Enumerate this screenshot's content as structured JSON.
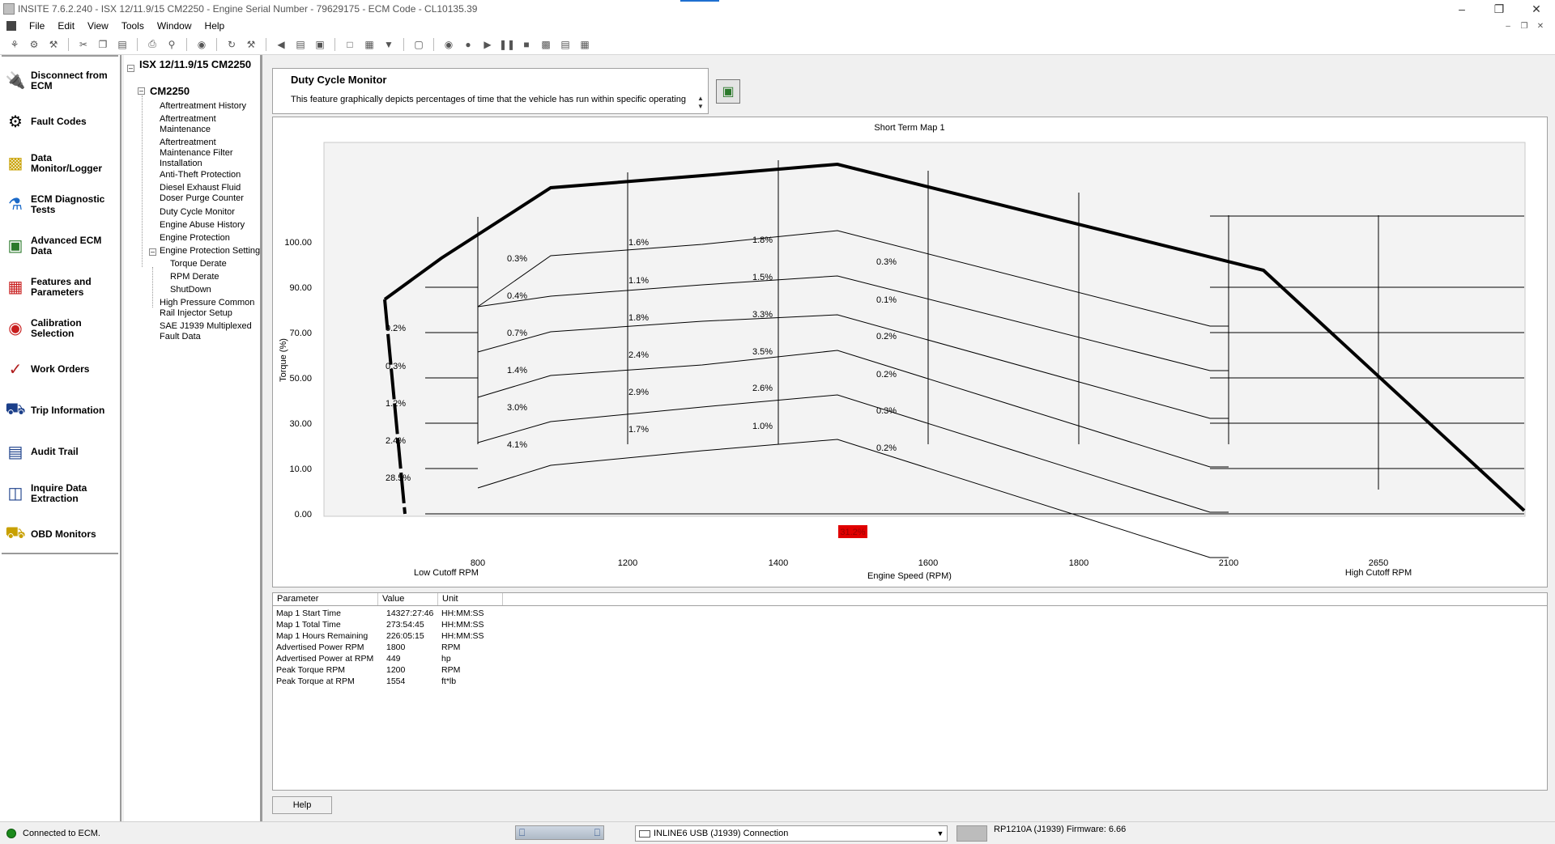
{
  "window": {
    "title": "INSITE 7.6.2.240 - ISX 12/11.9/15 CM2250 - Engine Serial Number - 79629175 - ECM Code - CL10135.39",
    "min_icon": "minimize-icon",
    "max_icon": "restore-icon",
    "close_icon": "close-icon"
  },
  "menubar": {
    "items": [
      "File",
      "Edit",
      "View",
      "Tools",
      "Window",
      "Help"
    ]
  },
  "nav": {
    "items": [
      {
        "label": "Disconnect from ECM",
        "icon": "disconnect-icon"
      },
      {
        "label": "Fault Codes",
        "icon": "fault-codes-icon"
      },
      {
        "label": "Data Monitor/Logger",
        "icon": "data-monitor-icon"
      },
      {
        "label": "ECM Diagnostic Tests",
        "icon": "diagnostic-tests-icon"
      },
      {
        "label": "Advanced ECM Data",
        "icon": "advanced-ecm-icon"
      },
      {
        "label": "Features and Parameters",
        "icon": "features-icon"
      },
      {
        "label": "Calibration Selection",
        "icon": "calibration-icon"
      },
      {
        "label": "Work Orders",
        "icon": "work-orders-icon"
      },
      {
        "label": "Trip Information",
        "icon": "trip-info-icon"
      },
      {
        "label": "Audit Trail",
        "icon": "audit-trail-icon"
      },
      {
        "label": "Inquire Data Extraction",
        "icon": "data-extraction-icon"
      },
      {
        "label": "OBD Monitors",
        "icon": "obd-icon"
      }
    ]
  },
  "tree": {
    "root": "ISX 12/11.9/15 CM2250",
    "child": "CM2250",
    "leaves": [
      "Aftertreatment History",
      "Aftertreatment Maintenance",
      "Aftertreatment Maintenance Filter Installation",
      "Anti-Theft Protection",
      "Diesel Exhaust Fluid Doser Purge Counter",
      "Duty Cycle Monitor",
      "Engine Abuse History",
      "Engine Protection",
      "Engine Protection Setting",
      "Torque Derate",
      "RPM Derate",
      "ShutDown",
      "High Pressure Common Rail Injector Setup",
      "SAE J1939 Multiplexed Fault Data"
    ]
  },
  "description": {
    "title": "Duty Cycle Monitor",
    "text": "This feature graphically depicts percentages of time that the vehicle has run within specific operating"
  },
  "chart_data": {
    "type": "area",
    "title": "Short Term Map 1",
    "xlabel": "Engine Speed (RPM)",
    "ylabel": "Torque (%)",
    "x_ticks": [
      "800",
      "1200",
      "1400",
      "1600",
      "1800",
      "2100",
      "2650"
    ],
    "x_tick_sublabels": {
      "800": "Low Cutoff RPM",
      "2650": "High Cutoff RPM"
    },
    "y_ticks": [
      "0.00",
      "10.00",
      "30.00",
      "50.00",
      "70.00",
      "90.00",
      "100.00"
    ],
    "cells": [
      [
        "0.2%",
        "0.3%",
        "1.2%",
        "2.4%",
        "28.5%"
      ],
      [
        "0.3%",
        "0.4%",
        "0.7%",
        "1.4%",
        "3.0%",
        "4.1%"
      ],
      [
        "1.6%",
        "1.1%",
        "1.8%",
        "2.4%",
        "2.9%",
        "1.7%"
      ],
      [
        "1.8%",
        "1.5%",
        "3.3%",
        "3.5%",
        "2.6%",
        "1.0%"
      ],
      [
        "0.3%",
        "0.1%",
        "0.2%",
        "0.2%",
        "0.3%",
        "0.2%"
      ]
    ],
    "idle_label": "31.2%",
    "idle_color": "#e00000"
  },
  "table": {
    "headers": {
      "parameter": "Parameter",
      "value": "Value",
      "unit": "Unit"
    },
    "rows": [
      {
        "param": "Map 1 Start Time",
        "value": "14327:27:46",
        "unit": "HH:MM:SS"
      },
      {
        "param": "Map 1 Total Time",
        "value": "273:54:45",
        "unit": "HH:MM:SS"
      },
      {
        "param": "Map 1 Hours Remaining",
        "value": "226:05:15",
        "unit": "HH:MM:SS"
      },
      {
        "param": "Advertised Power RPM",
        "value": "1800",
        "unit": "RPM"
      },
      {
        "param": "Advertised Power at RPM",
        "value": "449",
        "unit": "hp"
      },
      {
        "param": "Peak Torque RPM",
        "value": "1200",
        "unit": "RPM"
      },
      {
        "param": "Peak Torque at RPM",
        "value": "1554",
        "unit": "ft*lb"
      }
    ]
  },
  "help_label": "Help",
  "status": {
    "text": "Connected to ECM.",
    "connection": "INLINE6 USB (J1939) Connection",
    "firmware": "RP1210A (J1939)  Firmware: 6.66",
    "status_color": "#1c8a1c"
  }
}
